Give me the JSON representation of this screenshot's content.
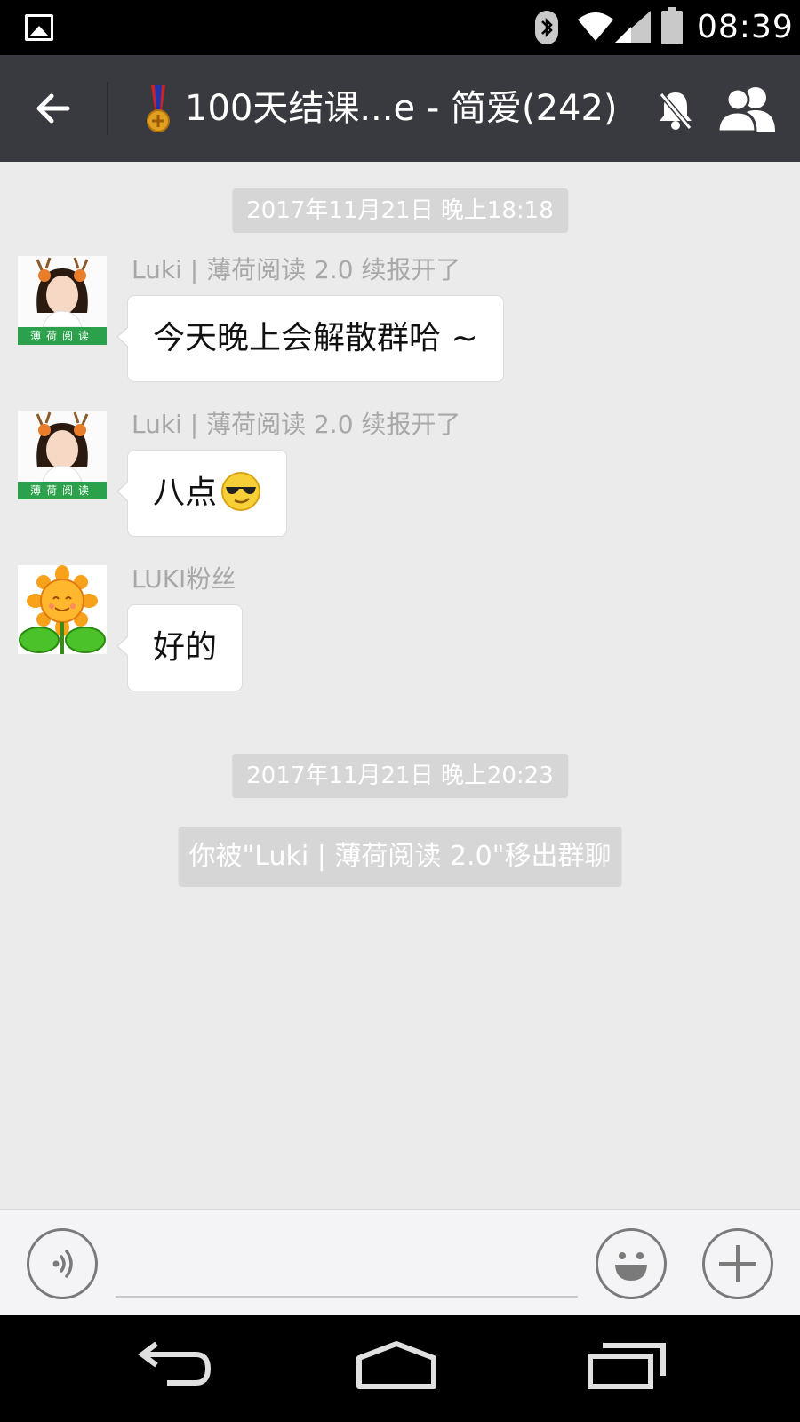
{
  "status_bar": {
    "time": "08:39",
    "icons": [
      "gallery-icon",
      "bluetooth-icon",
      "wifi-icon",
      "signal-icon",
      "battery-icon"
    ]
  },
  "header": {
    "title": "100天结课...e - 简爱(242)",
    "icons": [
      "back-arrow-icon",
      "medal-icon",
      "mute-bell-icon",
      "group-members-icon"
    ]
  },
  "chat": {
    "timestamps": [
      "2017年11月21日 晚上18:18",
      "2017年11月21日 晚上20:23"
    ],
    "messages": [
      {
        "sender": "Luki | 薄荷阅读 2.0 续报开了",
        "text": "今天晚上会解散群哈 ~",
        "avatar_tag": "薄荷阅读"
      },
      {
        "sender": "Luki | 薄荷阅读 2.0 续报开了",
        "text": "八点",
        "emoji": "sunglasses-emoji",
        "avatar_tag": "薄荷阅读"
      },
      {
        "sender": "LUKI粉丝",
        "text": "好的",
        "avatar": "sunflower-avatar"
      }
    ],
    "system_message": "你被\"Luki | 薄荷阅读 2.0\"移出群聊"
  },
  "input_bar": {
    "placeholder": "",
    "icons": [
      "voice-icon",
      "emoji-icon",
      "plus-icon"
    ]
  },
  "colors": {
    "nav_bg": "#393a3f",
    "chat_bg": "#ebebeb",
    "badge_bg": "#d6d6d6",
    "avatar_tag": "#2ca14b"
  }
}
